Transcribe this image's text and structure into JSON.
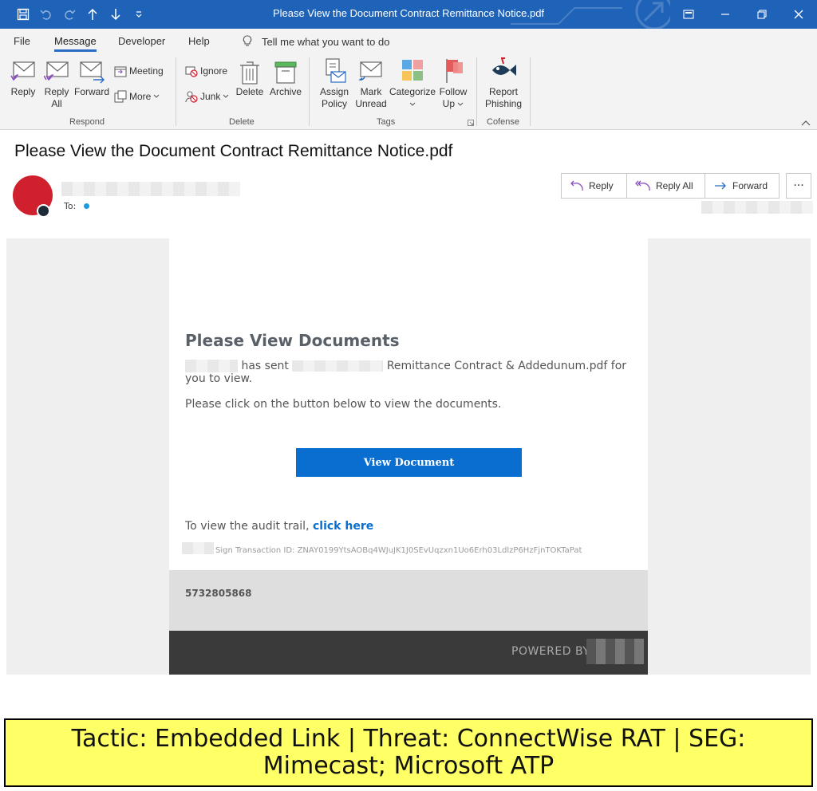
{
  "window": {
    "title": "Please View the Document Contract Remittance Notice.pdf"
  },
  "tabs": [
    "File",
    "Message",
    "Developer",
    "Help"
  ],
  "tell_me": "Tell me what you want to do",
  "ribbon": {
    "respond": {
      "reply": "Reply",
      "reply_all_1": "Reply",
      "reply_all_2": "All",
      "forward": "Forward",
      "meeting": "Meeting",
      "more": "More",
      "label": "Respond"
    },
    "delete": {
      "ignore": "Ignore",
      "junk": "Junk",
      "delete": "Delete",
      "archive": "Archive",
      "label": "Delete"
    },
    "tags": {
      "assign_1": "Assign",
      "assign_2": "Policy",
      "mark_1": "Mark",
      "mark_2": "Unread",
      "categorize": "Categorize",
      "follow_1": "Follow",
      "follow_2": "Up",
      "label": "Tags"
    },
    "cofense": {
      "report_1": "Report",
      "report_2": "Phishing",
      "label": "Cofense"
    }
  },
  "message": {
    "subject": "Please View the Document Contract Remittance Notice.pdf",
    "to_label": "To:",
    "actions": {
      "reply": "Reply",
      "reply_all": "Reply All",
      "forward": "Forward",
      "more": "···"
    }
  },
  "body": {
    "heading": "Please View Documents",
    "has_sent": "has sent",
    "doc_name": "Remittance Contract & Addedunum.pdf for you to view.",
    "instruction": "Please click on the button below to view the documents.",
    "button": "View Document",
    "audit_prefix": "To view the audit trail,",
    "audit_link": "click here",
    "transaction": "Sign Transaction ID: ZNAY0199YtsAOBq4WJuJK1J0SEvUqzxn1Uo6Erh03LdlzP6HzFjnTOKTaPat",
    "footer_number": "5732805868",
    "powered_by": "POWERED BY"
  },
  "banner": "Tactic: Embedded Link | Threat: ConnectWise RAT | SEG: Mimecast; Microsoft ATP",
  "colors": {
    "titlebar": "#1f63b8",
    "avatar": "#d0202e",
    "button": "#0a6ed1",
    "banner": "#ffff66"
  }
}
